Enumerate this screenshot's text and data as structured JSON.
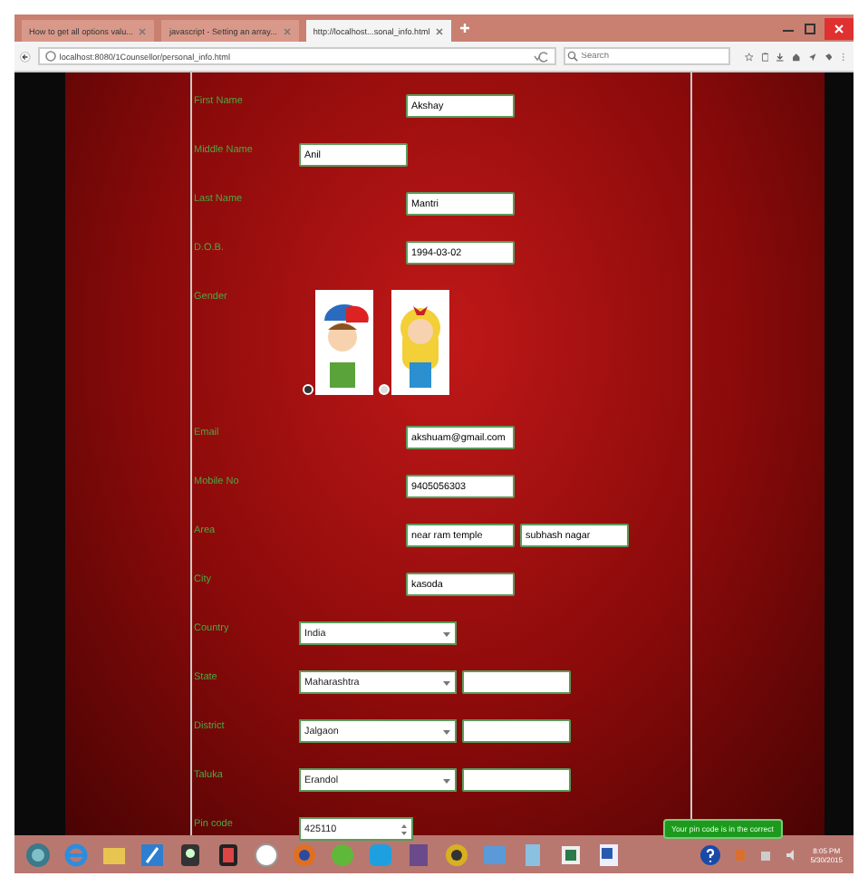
{
  "browser": {
    "tabs": [
      {
        "label": "How to get all options valu...",
        "selected": false
      },
      {
        "label": "javascript - Setting an array...",
        "selected": false
      },
      {
        "label": "http://localhost...sonal_info.html",
        "selected": true
      }
    ],
    "url": "localhost:8080/1Counsellor/personal_info.html",
    "search": {
      "placeholder": "Search"
    }
  },
  "form": {
    "fields": [
      {
        "kind": "text",
        "label": "First Name",
        "values": [
          "Akshay"
        ]
      },
      {
        "kind": "inline",
        "label": "Middle Name",
        "values": [
          "Anil"
        ]
      },
      {
        "kind": "text",
        "label": "Last Name",
        "values": [
          "Mantri"
        ]
      },
      {
        "kind": "text",
        "label": "D.O.B.",
        "values": [
          "1994-03-02"
        ]
      },
      {
        "kind": "gender",
        "label": "Gender",
        "options": [
          {
            "kind": "boy",
            "selected": true
          },
          {
            "kind": "girl",
            "selected": false
          }
        ]
      },
      {
        "kind": "text",
        "label": "Email",
        "values": [
          "akshuam@gmail.com"
        ]
      },
      {
        "kind": "text",
        "label": "Mobile No",
        "values": [
          "9405056303"
        ]
      },
      {
        "kind": "text",
        "label": "Area",
        "values": [
          "near ram temple",
          "subhash nagar"
        ]
      },
      {
        "kind": "text",
        "label": "City",
        "values": [
          "kasoda"
        ]
      },
      {
        "kind": "select",
        "label": "Country",
        "value": "India",
        "extra_field": false
      },
      {
        "kind": "select",
        "label": "State",
        "value": "Maharashtra",
        "extra_field": true
      },
      {
        "kind": "select",
        "label": "District",
        "value": "Jalgaon",
        "extra_field": true
      },
      {
        "kind": "select",
        "label": "Taluka",
        "value": "Erandol",
        "extra_field": true
      },
      {
        "kind": "number",
        "label": "Pin code",
        "value": "425110"
      }
    ],
    "tooltip": "Your pin code is in the correct"
  },
  "taskbar": {
    "clock": {
      "time": "8:05 PM",
      "date": "5/30/2015"
    }
  }
}
